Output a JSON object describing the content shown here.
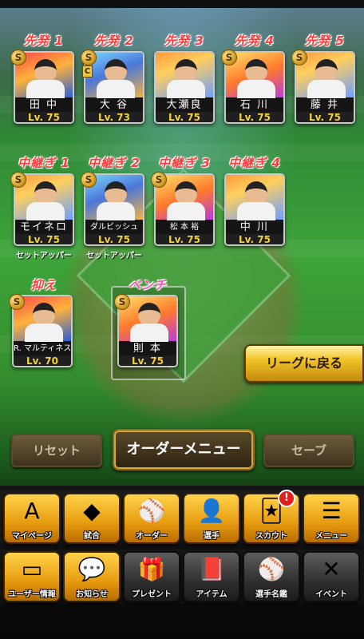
{
  "header": {
    "fragment": ""
  },
  "lineup": {
    "starters": [
      {
        "role": "先発 1",
        "name": "田 中",
        "level": "Lv. 75",
        "art": "b4",
        "badge": "S"
      },
      {
        "role": "先発 2",
        "name": "大 谷",
        "level": "Lv. 73",
        "art": "b2",
        "badge": "S",
        "sub_badge": "C"
      },
      {
        "role": "先発 3",
        "name": "大瀬良",
        "level": "Lv. 75",
        "art": "b1",
        "badge": ""
      },
      {
        "role": "先発 4",
        "name": "石 川",
        "level": "Lv. 75",
        "art": "b3",
        "badge": "S"
      },
      {
        "role": "先発 5",
        "name": "藤 井",
        "level": "Lv. 75",
        "art": "b1",
        "badge": "S"
      }
    ],
    "relievers": [
      {
        "role": "中継ぎ 1",
        "name": "モイネロ",
        "level": "Lv. 75",
        "art": "b1",
        "badge": "S",
        "sub_role": "セットアッパー"
      },
      {
        "role": "中継ぎ 2",
        "name": "ダルビッシュ",
        "level": "Lv. 75",
        "art": "b2",
        "badge": "S",
        "sub_role": "セットアッパー"
      },
      {
        "role": "中継ぎ 3",
        "name": "松 本 裕",
        "level": "Lv. 75",
        "art": "b3",
        "badge": "S"
      },
      {
        "role": "中継ぎ 4",
        "name": "中 川",
        "level": "Lv. 75",
        "art": "b1",
        "badge": ""
      }
    ],
    "closer": {
      "role": "抑え",
      "name": "R. マルティネス",
      "level": "Lv. 70",
      "art": "b4",
      "badge": "S"
    },
    "bench": {
      "role": "ベンチ",
      "name": "則 本",
      "level": "Lv. 75",
      "art": "b3",
      "badge": "S"
    }
  },
  "actions": {
    "league_back": "リーグに戻る",
    "reset": "リセット",
    "order_menu": "オーダーメニュー",
    "save": "セーブ"
  },
  "menu_row1": [
    {
      "label": "マイページ",
      "icon": "my-page-icon",
      "glyph": "A",
      "style": "gold"
    },
    {
      "label": "試合",
      "icon": "stadium-icon",
      "glyph": "◆",
      "style": "gold"
    },
    {
      "label": "オーダー",
      "icon": "order-icon",
      "glyph": "⚾",
      "style": "gold"
    },
    {
      "label": "選手",
      "icon": "player-icon",
      "glyph": "👤",
      "style": "gold"
    },
    {
      "label": "スカウト",
      "icon": "scout-icon",
      "glyph": "🃏",
      "style": "gold"
    },
    {
      "label": "メニュー",
      "icon": "menu-icon",
      "glyph": "☰",
      "style": "gold"
    }
  ],
  "menu_row2": [
    {
      "label": "ユーザー情報",
      "icon": "user-info-icon",
      "glyph": "▭",
      "style": "gold"
    },
    {
      "label": "お知らせ",
      "icon": "notice-icon",
      "glyph": "💬",
      "style": "gold"
    },
    {
      "label": "プレゼント",
      "icon": "present-icon",
      "glyph": "🎁",
      "style": "dark"
    },
    {
      "label": "アイテム",
      "icon": "item-icon",
      "glyph": "📕",
      "style": "dark"
    },
    {
      "label": "選手名鑑",
      "icon": "player-book-icon",
      "glyph": "⚾",
      "style": "dark"
    },
    {
      "label": "イベント",
      "icon": "event-icon",
      "glyph": "✕",
      "style": "dark"
    }
  ],
  "notification_badge": "!",
  "colors": {
    "role_label": "#ff3b3b",
    "bench_label": "#ff4fb0",
    "level_text": "#f5d23b",
    "gold_button": "#f2c327"
  }
}
